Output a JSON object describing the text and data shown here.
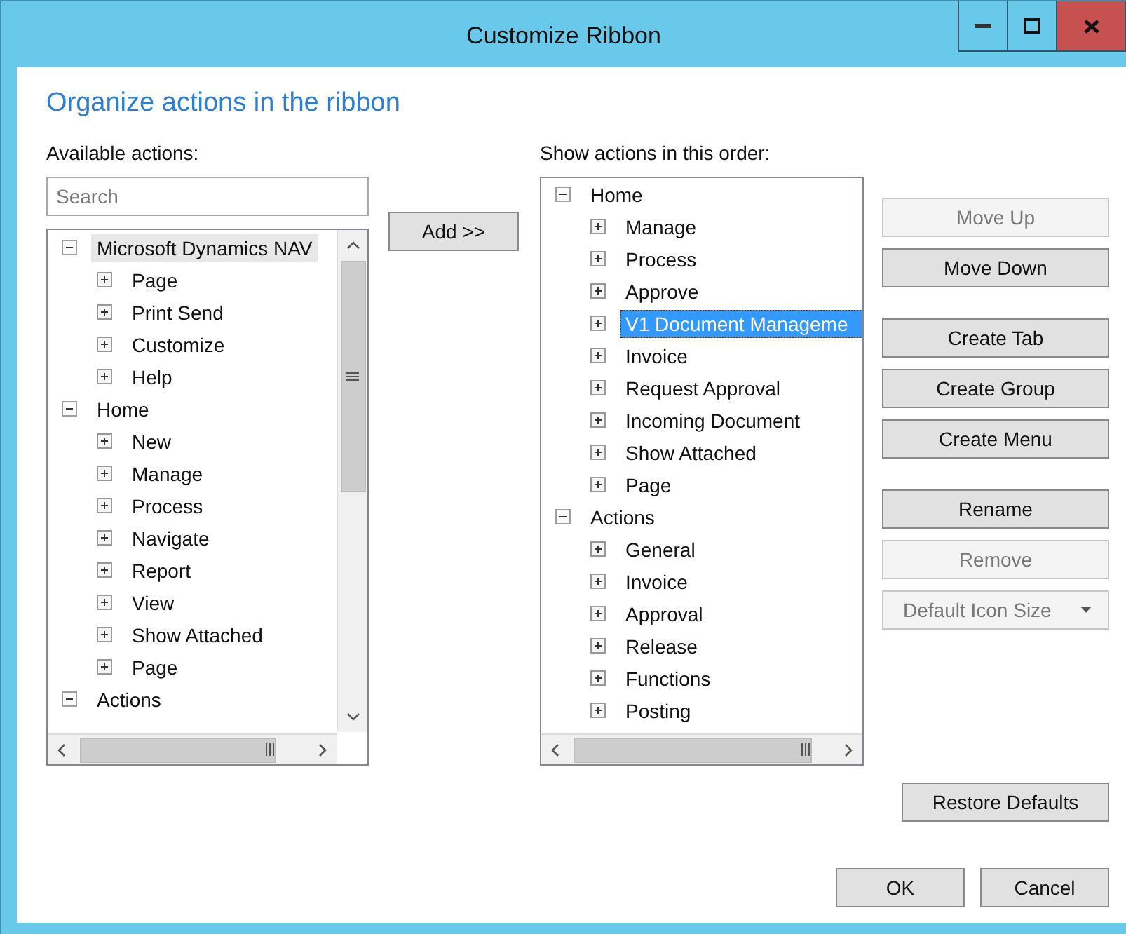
{
  "window": {
    "title": "Customize Ribbon"
  },
  "heading": "Organize actions in the ribbon",
  "available": {
    "label": "Available actions:",
    "search": {
      "placeholder": "Search"
    },
    "tree": [
      {
        "label": "Microsoft Dynamics NAV",
        "expanded": true,
        "selected": true,
        "children": [
          {
            "label": "Page",
            "expanded": false,
            "selected": false
          },
          {
            "label": "Print  Send",
            "expanded": false,
            "selected": false
          },
          {
            "label": "Customize",
            "expanded": false,
            "selected": false
          },
          {
            "label": "Help",
            "expanded": false,
            "selected": false
          }
        ]
      },
      {
        "label": "Home",
        "expanded": true,
        "selected": false,
        "children": [
          {
            "label": "New",
            "expanded": false,
            "selected": false
          },
          {
            "label": "Manage",
            "expanded": false,
            "selected": false
          },
          {
            "label": "Process",
            "expanded": false,
            "selected": false
          },
          {
            "label": "Navigate",
            "expanded": false,
            "selected": false
          },
          {
            "label": "Report",
            "expanded": false,
            "selected": false
          },
          {
            "label": "View",
            "expanded": false,
            "selected": false
          },
          {
            "label": "Show Attached",
            "expanded": false,
            "selected": false
          },
          {
            "label": "Page",
            "expanded": false,
            "selected": false
          }
        ]
      },
      {
        "label": "Actions",
        "expanded": true,
        "selected": false
      }
    ]
  },
  "add_button": "Add >>",
  "order": {
    "label": "Show actions in this order:",
    "tree": [
      {
        "label": "Home",
        "expanded": true,
        "selected": false,
        "children": [
          {
            "label": "Manage",
            "expanded": false,
            "selected": false
          },
          {
            "label": "Process",
            "expanded": false,
            "selected": false
          },
          {
            "label": "Approve",
            "expanded": false,
            "selected": false
          },
          {
            "label": "V1 Document Manageme",
            "expanded": false,
            "selected": true
          },
          {
            "label": "Invoice",
            "expanded": false,
            "selected": false
          },
          {
            "label": "Request Approval",
            "expanded": false,
            "selected": false
          },
          {
            "label": "Incoming Document",
            "expanded": false,
            "selected": false
          },
          {
            "label": "Show Attached",
            "expanded": false,
            "selected": false
          },
          {
            "label": "Page",
            "expanded": false,
            "selected": false
          }
        ]
      },
      {
        "label": "Actions",
        "expanded": true,
        "selected": false,
        "children": [
          {
            "label": "General",
            "expanded": false,
            "selected": false
          },
          {
            "label": "Invoice",
            "expanded": false,
            "selected": false
          },
          {
            "label": "Approval",
            "expanded": false,
            "selected": false
          },
          {
            "label": "Release",
            "expanded": false,
            "selected": false
          },
          {
            "label": "Functions",
            "expanded": false,
            "selected": false
          },
          {
            "label": "Posting",
            "expanded": false,
            "selected": false
          }
        ]
      }
    ]
  },
  "button_groups": [
    [
      {
        "label": "Move Up",
        "kind": "button",
        "disabled": true
      },
      {
        "label": "Move Down",
        "kind": "button",
        "disabled": false
      }
    ],
    [
      {
        "label": "Create Tab",
        "kind": "button",
        "disabled": false
      },
      {
        "label": "Create Group",
        "kind": "button",
        "disabled": false
      },
      {
        "label": "Create Menu",
        "kind": "button",
        "disabled": false
      }
    ],
    [
      {
        "label": "Rename",
        "kind": "button",
        "disabled": false
      },
      {
        "label": "Remove",
        "kind": "button",
        "disabled": true
      },
      {
        "label": "Default Icon Size",
        "kind": "dropdown",
        "disabled": true
      }
    ]
  ],
  "restore_button": "Restore Defaults",
  "footer_buttons": [
    "OK",
    "Cancel"
  ]
}
